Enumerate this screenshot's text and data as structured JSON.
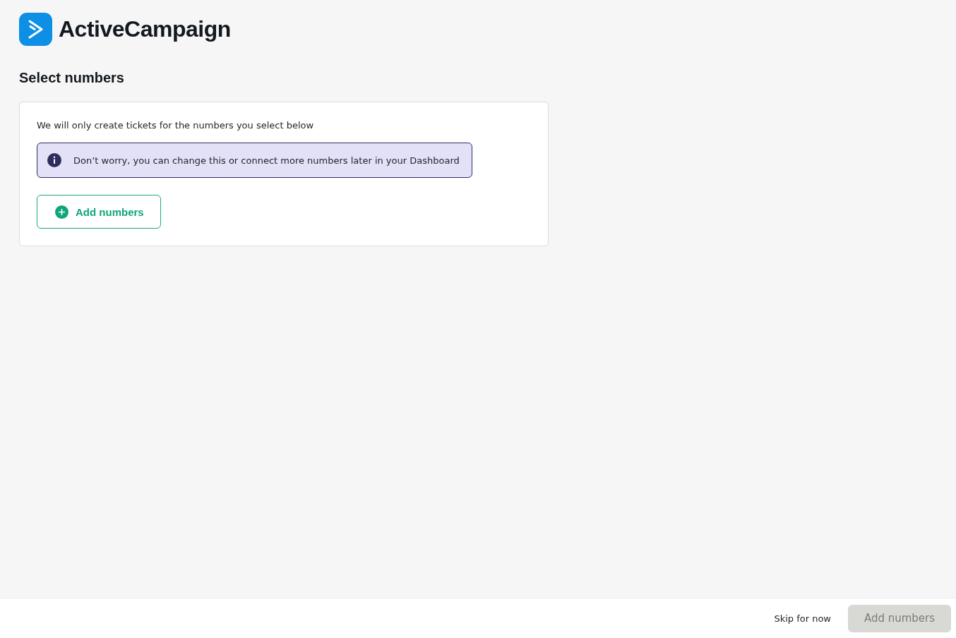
{
  "brand": {
    "name": "ActiveCampaign"
  },
  "heading": "Select numbers",
  "card": {
    "description": "We will only create tickets for the numbers you select below",
    "notice": "Don’t worry, you can change this or connect more numbers later in your Dashboard",
    "add_button": "Add numbers"
  },
  "footer": {
    "skip_button": "Skip for now",
    "submit_button": {
      "label": "Add numbers",
      "disabled": true
    }
  }
}
